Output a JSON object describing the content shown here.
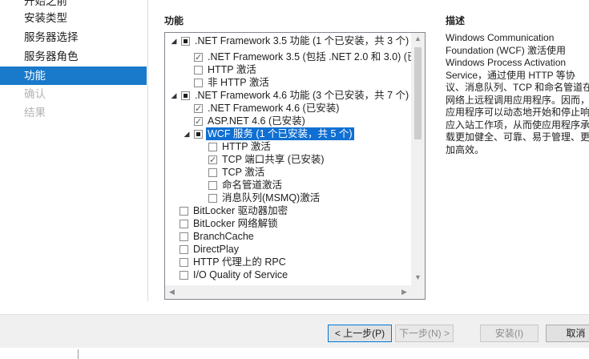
{
  "nav": {
    "items": [
      {
        "label": "开始之前",
        "state": "normal"
      },
      {
        "label": "安装类型",
        "state": "normal"
      },
      {
        "label": "服务器选择",
        "state": "normal"
      },
      {
        "label": "服务器角色",
        "state": "normal"
      },
      {
        "label": "功能",
        "state": "selected"
      },
      {
        "label": "确认",
        "state": "disabled"
      },
      {
        "label": "结果",
        "state": "disabled"
      }
    ]
  },
  "features": {
    "title": "功能",
    "tree": [
      {
        "label": ".NET Framework 3.5 功能 (1 个已安装，共 3 个)",
        "check": "partial",
        "expander": "collapse"
      },
      {
        "label": ".NET Framework 3.5 (包括 .NET 2.0 和 3.0) (已",
        "check": "checked"
      },
      {
        "label": "HTTP 激活",
        "check": "none"
      },
      {
        "label": "非 HTTP 激活",
        "check": "none"
      },
      {
        "label": ".NET Framework 4.6 功能 (3 个已安装，共 7 个)",
        "check": "partial",
        "expander": "collapse"
      },
      {
        "label": ".NET Framework 4.6 (已安装)",
        "check": "checked"
      },
      {
        "label": "ASP.NET 4.6 (已安装)",
        "check": "checked"
      },
      {
        "label": "WCF 服务 (1 个已安装，共 5 个)",
        "check": "partial",
        "expander": "collapse",
        "selected": true
      },
      {
        "label": "HTTP 激活",
        "check": "none"
      },
      {
        "label": "TCP 端口共享 (已安装)",
        "check": "checked"
      },
      {
        "label": "TCP 激活",
        "check": "none"
      },
      {
        "label": "命名管道激活",
        "check": "none"
      },
      {
        "label": "消息队列(MSMQ)激活",
        "check": "none"
      },
      {
        "label": "BitLocker 驱动器加密",
        "check": "none"
      },
      {
        "label": "BitLocker 网络解锁",
        "check": "none"
      },
      {
        "label": "BranchCache",
        "check": "none"
      },
      {
        "label": "DirectPlay",
        "check": "none"
      },
      {
        "label": "HTTP 代理上的 RPC",
        "check": "none"
      },
      {
        "label": "I/O Quality of Service",
        "check": "none"
      }
    ]
  },
  "description": {
    "title": "描述",
    "text": "Windows Communication Foundation (WCF) 激活使用 Windows Process Activation Service，通过使用 HTTP 等协议、消息队列、TCP 和命名管道在网络上远程调用应用程序。因而，应用程序可以动态地开始和停止响应入站工作项，从而使应用程序承载更加健全、可靠、易于管理、更加高效。"
  },
  "buttons": {
    "previous": "< 上一步(P)",
    "next": "下一步(N) >",
    "install": "安装(I)",
    "cancel": "取消"
  },
  "colors": {
    "accent": "#1979ca",
    "selection": "#0f6fd2"
  }
}
